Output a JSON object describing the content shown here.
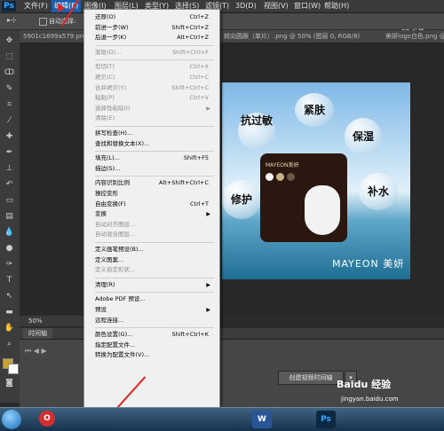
{
  "app": {
    "logo": "Ps",
    "workspace": "3D 功能"
  },
  "menubar": {
    "items": [
      "文件(F)",
      "编辑(E)",
      "图像(I)",
      "图层(L)",
      "类型(Y)",
      "选择(S)",
      "滤镜(T)",
      "3D(D)",
      "视图(V)",
      "窗口(W)",
      "帮助(H)"
    ],
    "active": "编辑(E)"
  },
  "optionsbar": {
    "auto_select": "自动选择:"
  },
  "tabs": [
    "5901c1699a579.png",
    "转向圆跟（单片）.png @ 50% (图层 0, RGB/8)",
    "美妍logo白色.png @"
  ],
  "artwork": {
    "bubbles": [
      "抗过敏",
      "紧肤",
      "保湿",
      "补水",
      "修护"
    ],
    "brand": "MAYEON 美妍",
    "package_brand": "MAYEON美妍"
  },
  "status": {
    "zoom": "50%"
  },
  "timeline": {
    "tab": "时间轴",
    "create_button": "创建视频时间轴"
  },
  "edit_menu": {
    "items": [
      {
        "label": "还原(O)",
        "shortcut": "Ctrl+Z",
        "disabled": false
      },
      {
        "label": "前进一步(W)",
        "shortcut": "Shift+Ctrl+Z",
        "disabled": false
      },
      {
        "label": "后退一步(K)",
        "shortcut": "Alt+Ctrl+Z",
        "disabled": false
      },
      {
        "sep": true
      },
      {
        "label": "渐隐(D)...",
        "shortcut": "Shift+Ctrl+F",
        "disabled": true
      },
      {
        "sep": true
      },
      {
        "label": "剪切(T)",
        "shortcut": "Ctrl+X",
        "disabled": true
      },
      {
        "label": "拷贝(C)",
        "shortcut": "Ctrl+C",
        "disabled": true
      },
      {
        "label": "合并拷贝(Y)",
        "shortcut": "Shift+Ctrl+C",
        "disabled": true
      },
      {
        "label": "粘贴(P)",
        "shortcut": "Ctrl+V",
        "disabled": true
      },
      {
        "label": "选择性粘贴(I)",
        "shortcut": "",
        "disabled": true,
        "submenu": true
      },
      {
        "label": "清除(E)",
        "shortcut": "",
        "disabled": true
      },
      {
        "sep": true
      },
      {
        "label": "拼写检查(H)...",
        "shortcut": "",
        "disabled": false
      },
      {
        "label": "查找和替换文本(X)...",
        "shortcut": "",
        "disabled": false
      },
      {
        "sep": true
      },
      {
        "label": "填充(L)...",
        "shortcut": "Shift+F5",
        "disabled": false
      },
      {
        "label": "描边(S)...",
        "shortcut": "",
        "disabled": false
      },
      {
        "sep": true
      },
      {
        "label": "内容识别比例",
        "shortcut": "Alt+Shift+Ctrl+C",
        "disabled": false
      },
      {
        "label": "操控变形",
        "shortcut": "",
        "disabled": false
      },
      {
        "label": "自由变换(F)",
        "shortcut": "Ctrl+T",
        "disabled": false
      },
      {
        "label": "变换",
        "shortcut": "",
        "disabled": false,
        "submenu": true
      },
      {
        "label": "自动对齐图层...",
        "shortcut": "",
        "disabled": true
      },
      {
        "label": "自动混合图层...",
        "shortcut": "",
        "disabled": true
      },
      {
        "sep": true
      },
      {
        "label": "定义画笔预设(B)...",
        "shortcut": "",
        "disabled": false
      },
      {
        "label": "定义图案...",
        "shortcut": "",
        "disabled": false
      },
      {
        "label": "定义自定形状...",
        "shortcut": "",
        "disabled": true
      },
      {
        "sep": true
      },
      {
        "label": "清理(R)",
        "shortcut": "",
        "disabled": false,
        "submenu": true
      },
      {
        "sep": true
      },
      {
        "label": "Adobe PDF 预设...",
        "shortcut": "",
        "disabled": false
      },
      {
        "label": "预设",
        "shortcut": "",
        "disabled": false,
        "submenu": true
      },
      {
        "label": "远程连接...",
        "shortcut": "",
        "disabled": false
      },
      {
        "sep": true
      },
      {
        "label": "颜色设置(G)...",
        "shortcut": "Shift+Ctrl+K",
        "disabled": false
      },
      {
        "label": "指定配置文件...",
        "shortcut": "",
        "disabled": false
      },
      {
        "label": "转换为配置文件(V)...",
        "shortcut": "",
        "disabled": false
      }
    ]
  },
  "watermark": {
    "text": "Baidu 经验",
    "url": "jingyan.baidu.com"
  },
  "taskbar": {
    "apps": [
      "O",
      "W",
      "Ps"
    ]
  },
  "colors": {
    "menu_highlight": "#1d5ea8",
    "arrow": "#e02424",
    "ps_blue": "#31a8ff"
  }
}
